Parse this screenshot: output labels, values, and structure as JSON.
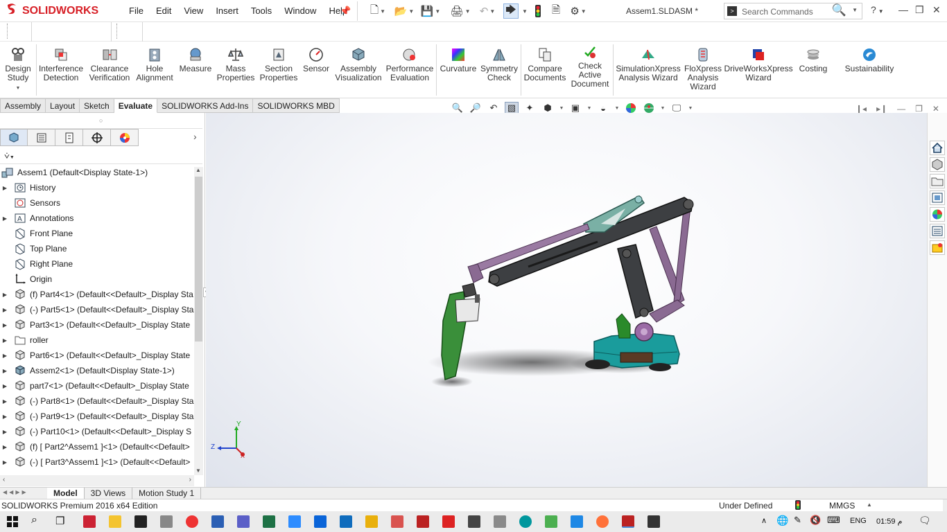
{
  "app": {
    "logo_text": "SOLIDWORKS",
    "document_title": "Assem1.SLDASM *"
  },
  "menu": [
    "File",
    "Edit",
    "View",
    "Insert",
    "Tools",
    "Window",
    "Help"
  ],
  "search": {
    "placeholder": "Search Commands"
  },
  "command_manager": [
    {
      "label": "Design\nStudy",
      "icon": "design-study-icon"
    },
    {
      "label": "Interference\nDetection",
      "icon": "interference-detection-icon"
    },
    {
      "label": "Clearance\nVerification",
      "icon": "clearance-verification-icon"
    },
    {
      "label": "Hole\nAlignment",
      "icon": "hole-alignment-icon"
    },
    {
      "label": "Measure",
      "icon": "measure-icon"
    },
    {
      "label": "Mass\nProperties",
      "icon": "mass-properties-icon"
    },
    {
      "label": "Section\nProperties",
      "icon": "section-properties-icon"
    },
    {
      "label": "Sensor",
      "icon": "sensor-icon"
    },
    {
      "label": "Assembly\nVisualization",
      "icon": "assembly-visualization-icon"
    },
    {
      "label": "Performance\nEvaluation",
      "icon": "performance-evaluation-icon"
    },
    {
      "label": "Curvature",
      "icon": "curvature-icon"
    },
    {
      "label": "Symmetry\nCheck",
      "icon": "symmetry-check-icon"
    },
    {
      "label": "Compare\nDocuments",
      "icon": "compare-documents-icon"
    },
    {
      "label": "Check\nActive\nDocument",
      "icon": "check-active-document-icon"
    },
    {
      "label": "SimulationXpress\nAnalysis Wizard",
      "icon": "simulationxpress-icon"
    },
    {
      "label": "FloXpress\nAnalysis\nWizard",
      "icon": "floxpress-icon"
    },
    {
      "label": "DriveWorksXpress\nWizard",
      "icon": "driveworksxpress-icon"
    },
    {
      "label": "Costing",
      "icon": "costing-icon"
    },
    {
      "label": "Sustainability",
      "icon": "sustainability-icon"
    }
  ],
  "tabs": [
    {
      "label": "Assembly",
      "active": false
    },
    {
      "label": "Layout",
      "active": false
    },
    {
      "label": "Sketch",
      "active": false
    },
    {
      "label": "Evaluate",
      "active": true
    },
    {
      "label": "SOLIDWORKS Add-Ins",
      "active": false
    },
    {
      "label": "SOLIDWORKS MBD",
      "active": false
    }
  ],
  "feature_tree": {
    "root": "Assem1  (Default<Display State-1>)",
    "items": [
      {
        "label": "History",
        "icon": "history-icon",
        "expandable": true
      },
      {
        "label": "Sensors",
        "icon": "sensors-icon",
        "expandable": false
      },
      {
        "label": "Annotations",
        "icon": "annotations-icon",
        "expandable": true
      },
      {
        "label": "Front Plane",
        "icon": "plane-icon",
        "expandable": false
      },
      {
        "label": "Top Plane",
        "icon": "plane-icon",
        "expandable": false
      },
      {
        "label": "Right Plane",
        "icon": "plane-icon",
        "expandable": false
      },
      {
        "label": "Origin",
        "icon": "origin-icon",
        "expandable": false
      },
      {
        "label": "(f) Part4<1> (Default<<Default>_Display Sta",
        "icon": "part-icon",
        "expandable": true
      },
      {
        "label": "(-) Part5<1> (Default<<Default>_Display Sta",
        "icon": "part-icon",
        "expandable": true
      },
      {
        "label": "Part3<1> (Default<<Default>_Display State",
        "icon": "part-icon",
        "expandable": true
      },
      {
        "label": "roller",
        "icon": "folder-icon",
        "expandable": true
      },
      {
        "label": "Part6<1> (Default<<Default>_Display State",
        "icon": "part-icon",
        "expandable": true
      },
      {
        "label": "Assem2<1> (Default<Display State-1>)",
        "icon": "subassembly-icon",
        "expandable": true
      },
      {
        "label": "part7<1> (Default<<Default>_Display State",
        "icon": "part-icon",
        "expandable": true
      },
      {
        "label": "(-) Part8<1> (Default<<Default>_Display Sta",
        "icon": "part-icon",
        "expandable": true
      },
      {
        "label": "(-) Part9<1> (Default<<Default>_Display Sta",
        "icon": "part-icon",
        "expandable": true
      },
      {
        "label": "(-) Part10<1> (Default<<Default>_Display S",
        "icon": "part-icon",
        "expandable": true
      },
      {
        "label": "(f) [ Part2^Assem1 ]<1> (Default<<Default>",
        "icon": "part-icon",
        "expandable": true
      },
      {
        "label": "(-) [ Part3^Assem1 ]<1> (Default<<Default>",
        "icon": "part-icon",
        "expandable": true
      }
    ]
  },
  "triad": {
    "y": "Y",
    "z": "Z",
    "x": "X"
  },
  "bottom_tabs": [
    {
      "label": "Model",
      "active": true
    },
    {
      "label": "3D Views",
      "active": false
    },
    {
      "label": "Motion Study 1",
      "active": false
    }
  ],
  "status": {
    "product": "SOLIDWORKS Premium 2016 x64 Edition",
    "state": "Under Defined",
    "units": "MMGS"
  },
  "taskbar": {
    "language": "ENG",
    "time": "01:59 م",
    "taskbar_date_hidden": ""
  },
  "colors": {
    "brand": "#d71f26",
    "arm_dark": "#3d3f42",
    "arm_purple": "#8a6a92",
    "gripper_green": "#3a8f3a",
    "base_teal": "#1a9c9c",
    "link_teal": "#7ab0a5"
  }
}
